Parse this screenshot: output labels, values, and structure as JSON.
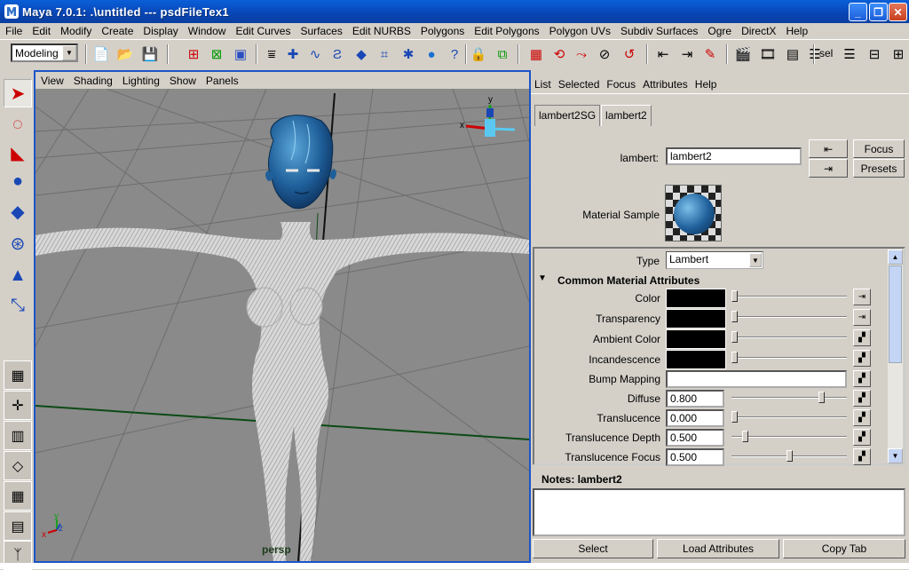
{
  "window": {
    "title": "Maya 7.0.1: .\\untitled    ---    psdFileTex1"
  },
  "menubar": [
    "File",
    "Edit",
    "Modify",
    "Create",
    "Display",
    "Window",
    "Edit Curves",
    "Surfaces",
    "Edit NURBS",
    "Polygons",
    "Edit Polygons",
    "Polygon UVs",
    "Subdiv Surfaces",
    "Ogre",
    "DirectX",
    "Help"
  ],
  "toolbar": {
    "mode": "Modeling",
    "sel_label": "sel"
  },
  "viewport": {
    "menu": [
      "View",
      "Shading",
      "Lighting",
      "Show",
      "Panels"
    ],
    "camera_label": "persp",
    "axis_x": "x",
    "axis_y": "y",
    "axis_z": "z"
  },
  "attribute_editor": {
    "menu": [
      "List",
      "Selected",
      "Focus",
      "Attributes",
      "Help"
    ],
    "tabs": [
      "lambert2SG",
      "lambert2"
    ],
    "active_tab": "lambert2",
    "node_type_label": "lambert:",
    "node_name": "lambert2",
    "focus_button": "Focus",
    "presets_button": "Presets",
    "material_sample_label": "Material Sample",
    "type_label": "Type",
    "type_value": "Lambert",
    "section_title": "Common Material Attributes",
    "color_attrs": [
      {
        "label": "Color"
      },
      {
        "label": "Transparency"
      },
      {
        "label": "Ambient Color"
      },
      {
        "label": "Incandescence"
      }
    ],
    "bump_label": "Bump Mapping",
    "numeric_attrs": [
      {
        "label": "Diffuse",
        "value": "0.800",
        "fraction": 0.8
      },
      {
        "label": "Translucence",
        "value": "0.000",
        "fraction": 0.0
      },
      {
        "label": "Translucence Depth",
        "value": "0.500",
        "fraction": 0.1
      },
      {
        "label": "Translucence Focus",
        "value": "0.500",
        "fraction": 0.5
      }
    ],
    "notes_label": "Notes:  lambert2",
    "buttons": {
      "select": "Select",
      "load": "Load Attributes",
      "copy": "Copy Tab"
    }
  },
  "colors": {
    "titlebar": "#0a4fc8",
    "viewport_bg": "#8a8a8a",
    "head_blue": "#1f5f9a",
    "active_border": "#1c55c8"
  }
}
